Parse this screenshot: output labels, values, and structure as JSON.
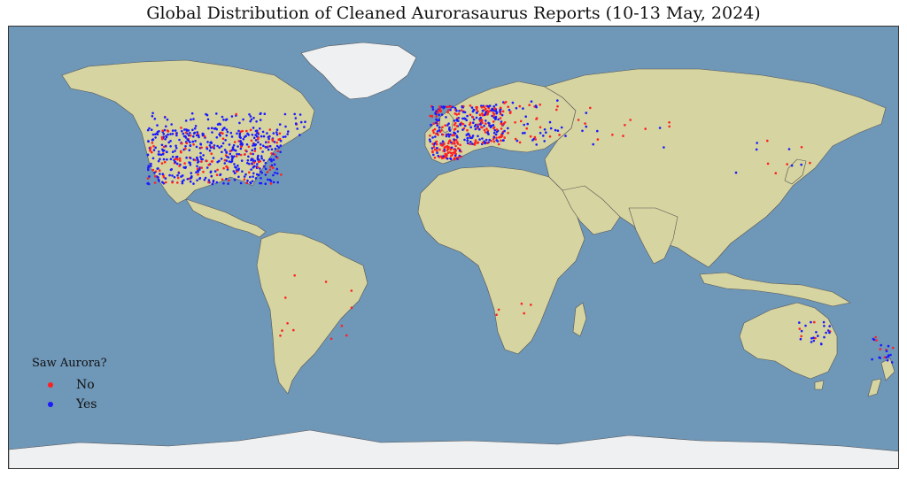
{
  "title": "Global Distribution of Cleaned Aurorasaurus Reports (10-13 May, 2024)",
  "colors": {
    "ocean": "#6f97b8",
    "land": "#d6d4a0",
    "ice": "#f2f4f6",
    "no": "#ff2020",
    "yes": "#1a1aff"
  },
  "legend": {
    "title": "Saw Aurora?",
    "items": [
      {
        "label": "No",
        "color": "#ff2020"
      },
      {
        "label": "Yes",
        "color": "#1a1aff"
      }
    ]
  },
  "map_data": {
    "projection": "plate carree",
    "clusters": [
      {
        "region": "United States",
        "lon": [
          -124,
          -70
        ],
        "lat": [
          26,
          49
        ],
        "count": 520,
        "yes_ratio": 0.75
      },
      {
        "region": "Canada (south)",
        "lon": [
          -125,
          -60
        ],
        "lat": [
          45,
          55
        ],
        "count": 90,
        "yes_ratio": 0.9
      },
      {
        "region": "Western Europe",
        "lon": [
          -10,
          20
        ],
        "lat": [
          42,
          58
        ],
        "count": 320,
        "yes_ratio": 0.55
      },
      {
        "region": "Iberia",
        "lon": [
          -9,
          3
        ],
        "lat": [
          36,
          43
        ],
        "count": 90,
        "yes_ratio": 0.25
      },
      {
        "region": "Eastern Europe",
        "lon": [
          15,
          45
        ],
        "lat": [
          42,
          60
        ],
        "count": 70,
        "yes_ratio": 0.55
      },
      {
        "region": "Central Asia",
        "lon": [
          50,
          90
        ],
        "lat": [
          40,
          58
        ],
        "count": 18,
        "yes_ratio": 0.5
      },
      {
        "region": "East Asia",
        "lon": [
          110,
          145
        ],
        "lat": [
          30,
          45
        ],
        "count": 12,
        "yes_ratio": 0.5
      },
      {
        "region": "South America",
        "lon": [
          -75,
          -40
        ],
        "lat": [
          -40,
          -5
        ],
        "count": 12,
        "yes_ratio": 0.2
      },
      {
        "region": "Southern Africa",
        "lon": [
          15,
          32
        ],
        "lat": [
          -34,
          -18
        ],
        "count": 5,
        "yes_ratio": 0.2
      },
      {
        "region": "SE Australia",
        "lon": [
          138,
          152
        ],
        "lat": [
          -39,
          -30
        ],
        "count": 25,
        "yes_ratio": 0.85
      },
      {
        "region": "New Zealand",
        "lon": [
          168,
          178
        ],
        "lat": [
          -47,
          -36
        ],
        "count": 20,
        "yes_ratio": 0.85
      }
    ]
  }
}
